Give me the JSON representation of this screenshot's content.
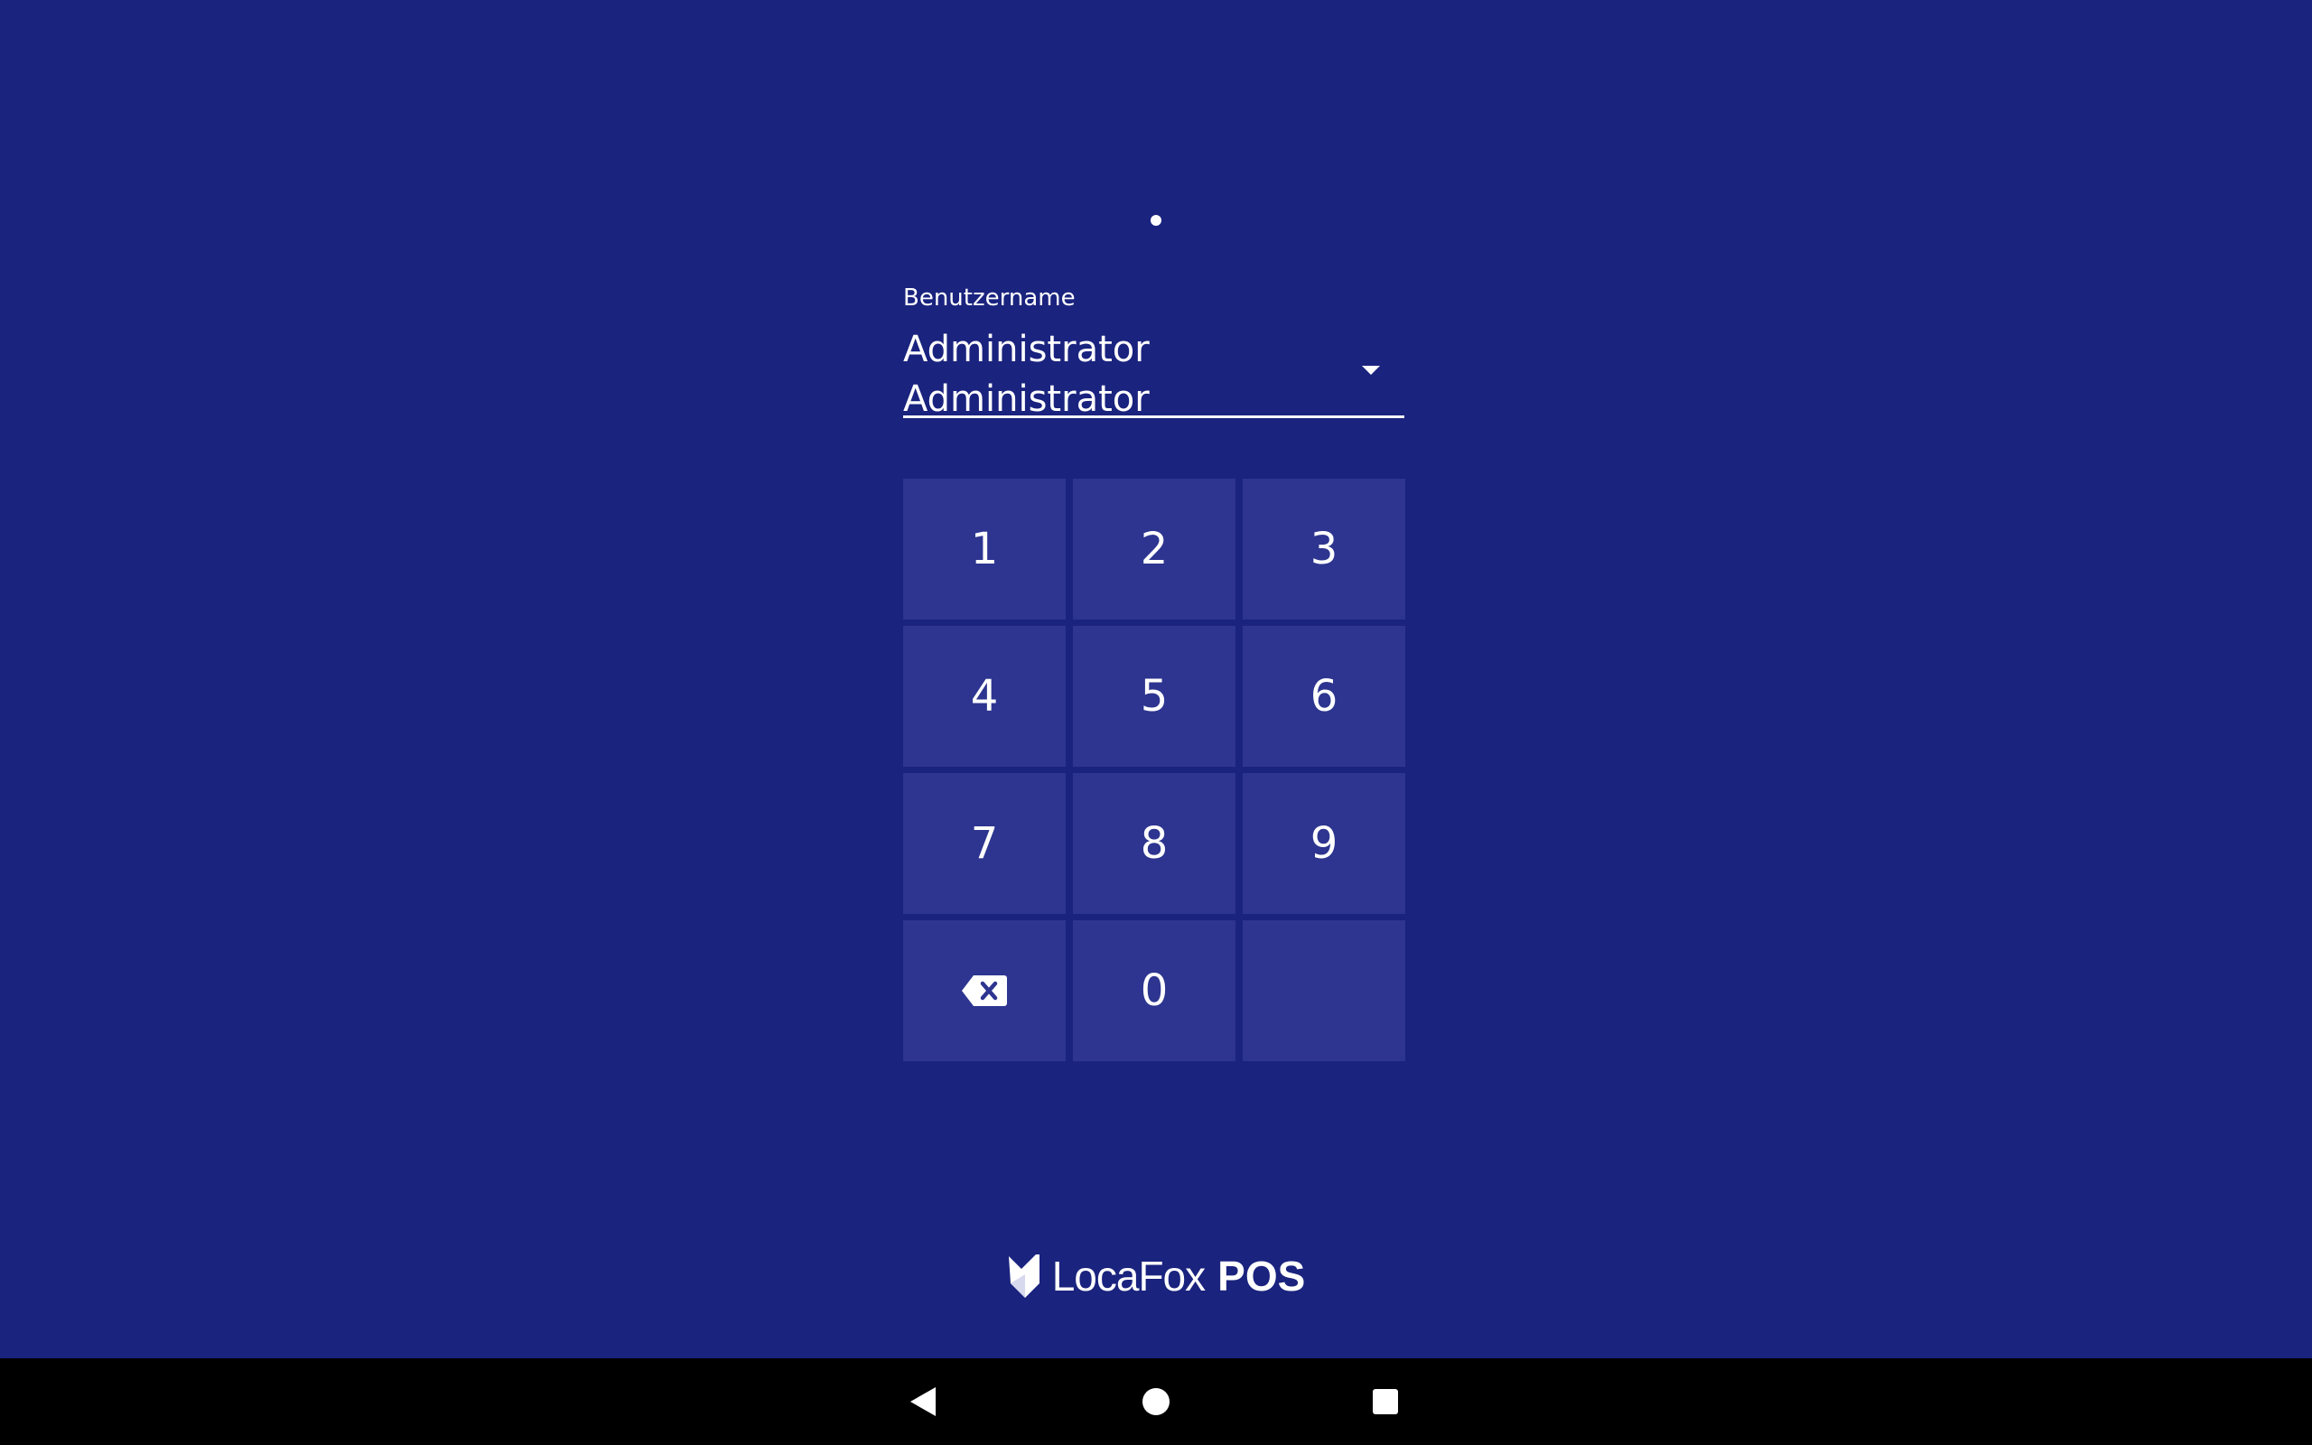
{
  "login": {
    "pin_entered_count": 1,
    "username_label": "Benutzername",
    "username_value": "Administrator Administrator"
  },
  "keypad": {
    "keys": [
      "1",
      "2",
      "3",
      "4",
      "5",
      "6",
      "7",
      "8",
      "9",
      "",
      "0",
      ""
    ],
    "backspace_icon": "backspace-icon"
  },
  "brand": {
    "name": "LocaFox",
    "suffix": "POS"
  },
  "navbar": {
    "back_icon": "back-icon",
    "home_icon": "home-icon",
    "recents_icon": "recents-icon"
  },
  "colors": {
    "background": "#1a237e",
    "key_background": "#2d3590",
    "text": "#ffffff",
    "navbar": "#000000"
  }
}
